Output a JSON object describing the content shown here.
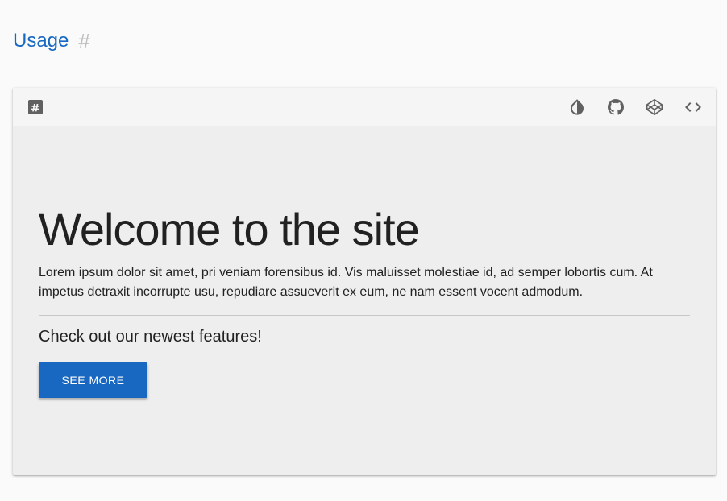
{
  "section": {
    "title": "Usage",
    "anchor": "#"
  },
  "toolbar": {
    "left_icon": "hash-box-icon",
    "right_icons": [
      "invert-colors-icon",
      "github-icon",
      "codepen-icon",
      "code-icon"
    ]
  },
  "demo": {
    "title": "Welcome to the site",
    "lead": "Lorem ipsum dolor sit amet, pri veniam forensibus id. Vis maluisset molestiae id, ad semper lobortis cum. At impetus detraxit incorrupte usu, repudiare assueverit ex eum, ne nam essent vocent admodum.",
    "subheading": "Check out our newest features!",
    "button_label": "SEE MORE"
  },
  "colors": {
    "accent": "#1867c0",
    "anchor": "#bdbdbd",
    "icon": "#616161"
  }
}
